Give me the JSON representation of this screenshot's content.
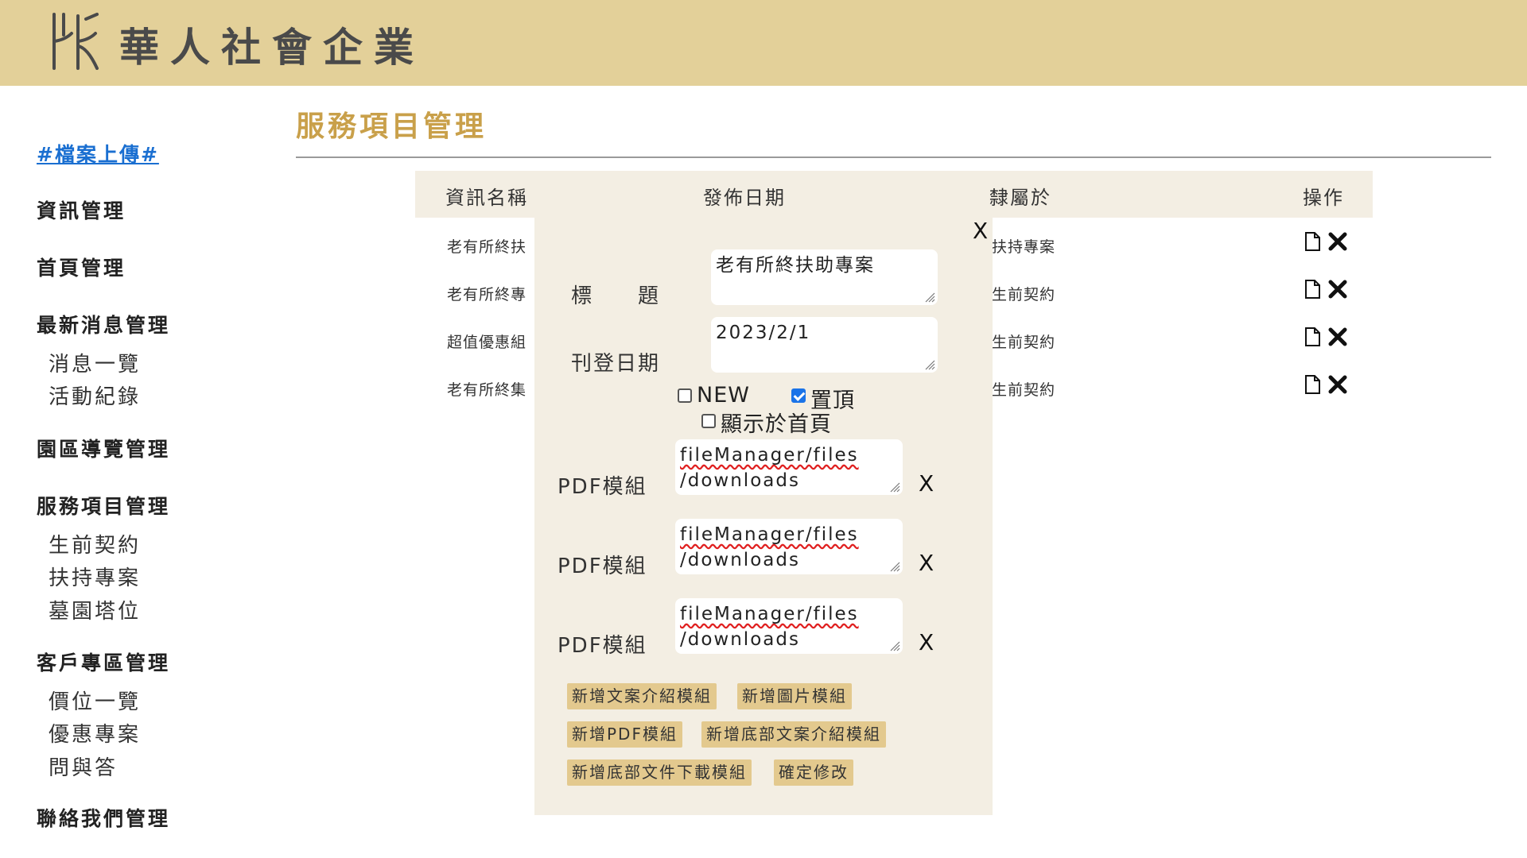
{
  "header": {
    "brand": "華人社會企業",
    "logo_icon": "hr-monogram-icon"
  },
  "sidebar": {
    "upload_link": "#檔案上傳#",
    "groups": [
      {
        "label": "資訊管理"
      },
      {
        "label": "首頁管理"
      },
      {
        "label": "最新消息管理",
        "items": [
          "消息一覽",
          "活動紀錄"
        ]
      },
      {
        "label": "園區導覽管理"
      },
      {
        "label": "服務項目管理",
        "items": [
          "生前契約",
          "扶持專案",
          "墓園塔位"
        ]
      },
      {
        "label": "客戶專區管理",
        "items": [
          "價位一覽",
          "優惠專案",
          "問與答"
        ]
      },
      {
        "label": "聯絡我們管理"
      }
    ]
  },
  "main": {
    "title": "服務項目管理",
    "columns": [
      "資訊名稱",
      "發佈日期",
      "隸屬於",
      "操作"
    ],
    "rows": [
      {
        "name": "老有所終扶",
        "category": "扶持專案"
      },
      {
        "name": "老有所終專",
        "category": "生前契約"
      },
      {
        "name": "超值優惠組",
        "category": "生前契約"
      },
      {
        "name": "老有所終集",
        "category": "生前契約"
      }
    ],
    "row_ops": [
      "copy-icon",
      "delete-icon"
    ]
  },
  "modal": {
    "close": "X",
    "title_label": "標　　題",
    "title_value": "老有所終扶助專案",
    "date_label": "刊登日期",
    "date_value": "2023/2/1",
    "checkboxes": [
      {
        "label": "NEW",
        "checked": false
      },
      {
        "label": "置頂",
        "checked": true
      },
      {
        "label": "顯示於首頁",
        "checked": false
      }
    ],
    "pdf_modules": [
      {
        "label": "PDF模組",
        "value_line1": "fileManager/files",
        "value_line2": "/downloads",
        "remove": "X"
      },
      {
        "label": "PDF模組",
        "value_line1": "fileManager/files",
        "value_line2": "/downloads",
        "remove": "X"
      },
      {
        "label": "PDF模組",
        "value_line1": "fileManager/files",
        "value_line2": "/downloads",
        "remove": "X"
      }
    ],
    "buttons": [
      "新增文案介紹模組",
      "新增圖片模組",
      "新增PDF模組",
      "新增底部文案介紹模組",
      "新增底部文件下載模組",
      "確定修改"
    ]
  },
  "colors": {
    "header_bg": "#e3d099",
    "accent": "#c9a04a",
    "link": "#1a6fd1",
    "panel_bg": "#f3eee3",
    "button_bg": "#e3c98e"
  }
}
